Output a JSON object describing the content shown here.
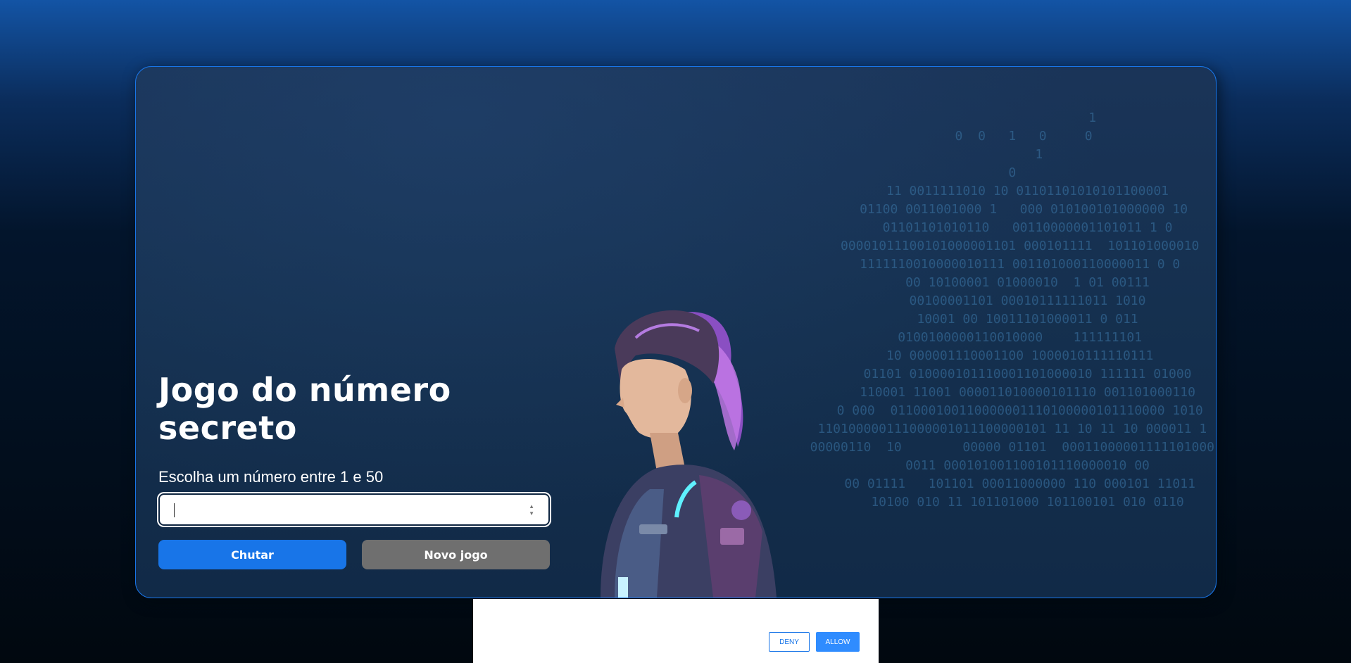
{
  "game": {
    "title": "Jogo do número secreto",
    "subtitle": "Escolha um número entre 1 e 50",
    "input_value": "",
    "guess_label": "Chutar",
    "new_game_label": "Novo jogo"
  },
  "decoration": {
    "binary_lines": [
      "                       1",
      "     0  0   1   0     0",
      "         1",
      "  0",
      "      11 0011111010 10 01101101010101100001",
      "     01100 0011001000 1   000 010100101000000 10",
      "      01101101010110   00110000001101011 1 0",
      "    00001011100101000001101 000101111  101101000010",
      "    1111110010000010111 001101000110000011 0 0",
      "      00 10100001 01000010  1 01 00111",
      "      00100001101 00010111111011 1010",
      "      10001 00 10011101000011 0 011",
      "    0100100000110010000    111111101",
      "    10 000001110001100 1000010111110111",
      "      01101 010000101110001101000010 111111 01000",
      "      110001 11001 000011010000101110 001101000110",
      "    0 000  011000100110000001110100000101110000 1010",
      "  110100000111000001011100000101 11 10 11 10 000011 1",
      "  00000110  10        00000 01101  00011000001111101000",
      "      0011 000101001100101110000010 00",
      "    00 01111   101101 00011000000 110 000101 11011",
      "      10100 010 11 101101000 101100101 010 0110"
    ]
  },
  "consent": {
    "deny_label": "DENY",
    "allow_label": "ALLOW"
  }
}
